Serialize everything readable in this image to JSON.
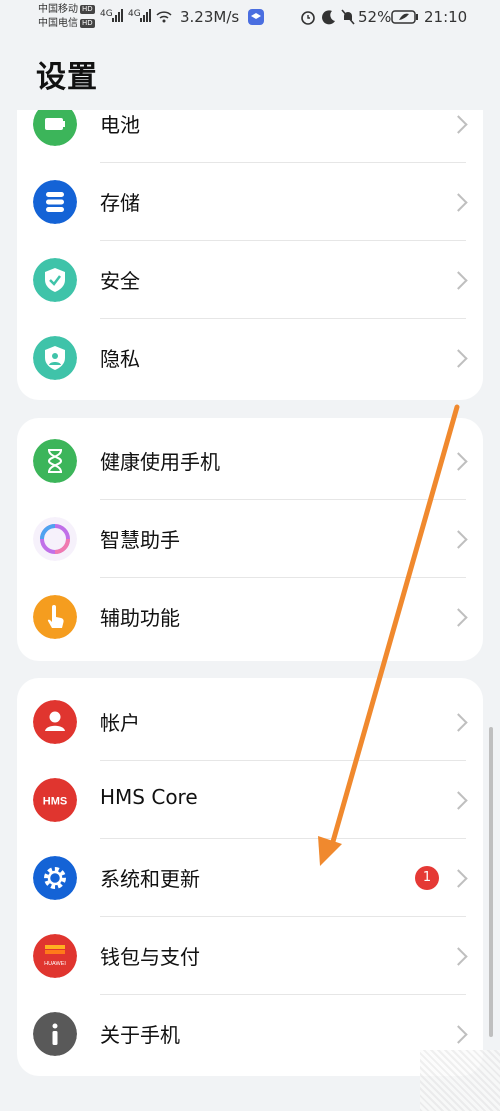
{
  "status_bar": {
    "carrier1": "中国移动",
    "carrier2": "中国电信",
    "hd": "HD",
    "net": "4G",
    "speed": "3.23M/s",
    "battery": "52%",
    "time": "21:10"
  },
  "page": {
    "title": "设置"
  },
  "groups": [
    {
      "items": [
        {
          "label": "电池",
          "icon": "battery-icon",
          "color": "#3cb55a"
        },
        {
          "label": "存储",
          "icon": "storage-icon",
          "color": "#1463d6"
        },
        {
          "label": "安全",
          "icon": "shield-icon",
          "color": "#3fc3a9"
        },
        {
          "label": "隐私",
          "icon": "privacy-icon",
          "color": "#3fc3a9"
        }
      ]
    },
    {
      "items": [
        {
          "label": "健康使用手机",
          "icon": "hourglass-icon",
          "color": "#3cb55a"
        },
        {
          "label": "智慧助手",
          "icon": "assistant-ring-icon",
          "color": "#c070e8"
        },
        {
          "label": "辅助功能",
          "icon": "hand-icon",
          "color": "#f59d1f"
        }
      ]
    },
    {
      "items": [
        {
          "label": "帐户",
          "icon": "account-icon",
          "color": "#e0352f"
        },
        {
          "label": "HMS Core",
          "icon": "hms-icon",
          "color": "#e0352f",
          "icon_text": "HMS"
        },
        {
          "label": "系统和更新",
          "icon": "gear-icon",
          "color": "#1463d6",
          "badge": "1"
        },
        {
          "label": "钱包与支付",
          "icon": "wallet-icon",
          "color": "#e0352f",
          "icon_text": "HUAWEI"
        },
        {
          "label": "关于手机",
          "icon": "info-icon",
          "color": "#595959"
        }
      ]
    }
  ],
  "colors": {
    "annotation_arrow": "#f0892e",
    "badge": "#e53935"
  }
}
